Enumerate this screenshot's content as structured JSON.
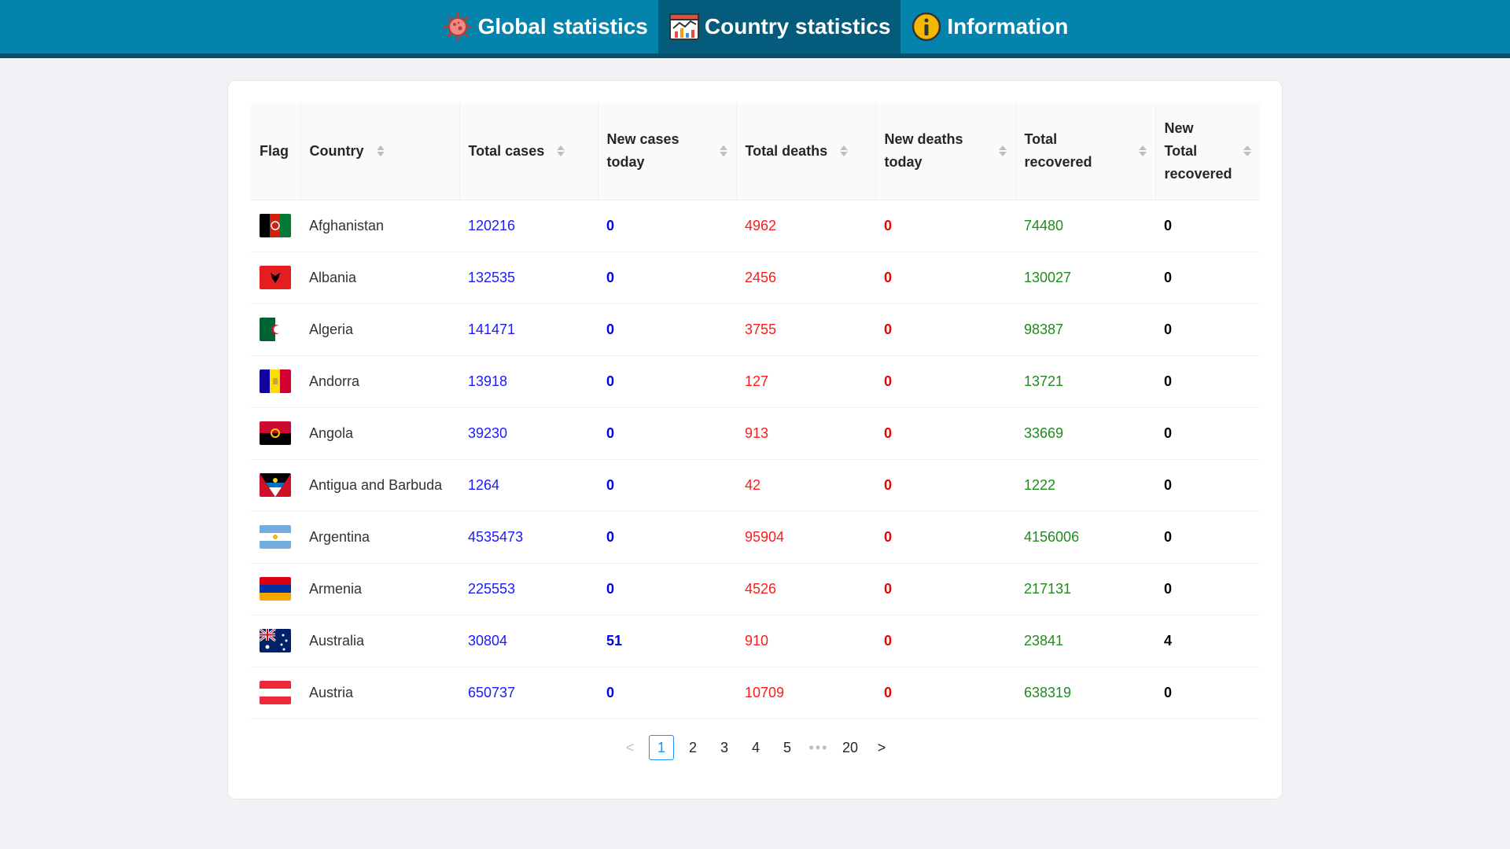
{
  "nav": [
    {
      "label": "Global statistics",
      "icon": "virus-icon"
    },
    {
      "label": "Country statistics",
      "icon": "chart-icon"
    },
    {
      "label": "Information",
      "icon": "info-icon"
    }
  ],
  "table": {
    "headers": {
      "flag": "Flag",
      "country": "Country",
      "total_cases": "Total cases",
      "new_cases_l1": "New cases",
      "new_cases_l2": "today",
      "total_deaths": "Total deaths",
      "new_deaths_l1": "New deaths",
      "new_deaths_l2": "today",
      "total_recovered_l1": "Total",
      "total_recovered_l2": "recovered",
      "new_recovered_l1": "New",
      "new_recovered_l2": "Total",
      "new_recovered_l3": "recovered"
    },
    "rows": [
      {
        "country": "Afghanistan",
        "total_cases": "120216",
        "new_cases": "0",
        "total_deaths": "4962",
        "new_deaths": "0",
        "total_recovered": "74480",
        "new_recovered": "0"
      },
      {
        "country": "Albania",
        "total_cases": "132535",
        "new_cases": "0",
        "total_deaths": "2456",
        "new_deaths": "0",
        "total_recovered": "130027",
        "new_recovered": "0"
      },
      {
        "country": "Algeria",
        "total_cases": "141471",
        "new_cases": "0",
        "total_deaths": "3755",
        "new_deaths": "0",
        "total_recovered": "98387",
        "new_recovered": "0"
      },
      {
        "country": "Andorra",
        "total_cases": "13918",
        "new_cases": "0",
        "total_deaths": "127",
        "new_deaths": "0",
        "total_recovered": "13721",
        "new_recovered": "0"
      },
      {
        "country": "Angola",
        "total_cases": "39230",
        "new_cases": "0",
        "total_deaths": "913",
        "new_deaths": "0",
        "total_recovered": "33669",
        "new_recovered": "0"
      },
      {
        "country": "Antigua and Barbuda",
        "total_cases": "1264",
        "new_cases": "0",
        "total_deaths": "42",
        "new_deaths": "0",
        "total_recovered": "1222",
        "new_recovered": "0"
      },
      {
        "country": "Argentina",
        "total_cases": "4535473",
        "new_cases": "0",
        "total_deaths": "95904",
        "new_deaths": "0",
        "total_recovered": "4156006",
        "new_recovered": "0"
      },
      {
        "country": "Armenia",
        "total_cases": "225553",
        "new_cases": "0",
        "total_deaths": "4526",
        "new_deaths": "0",
        "total_recovered": "217131",
        "new_recovered": "0"
      },
      {
        "country": "Australia",
        "total_cases": "30804",
        "new_cases": "51",
        "total_deaths": "910",
        "new_deaths": "0",
        "total_recovered": "23841",
        "new_recovered": "4"
      },
      {
        "country": "Austria",
        "total_cases": "650737",
        "new_cases": "0",
        "total_deaths": "10709",
        "new_deaths": "0",
        "total_recovered": "638319",
        "new_recovered": "0"
      }
    ]
  },
  "pagination": {
    "prev": "<",
    "pages": [
      "1",
      "2",
      "3",
      "4",
      "5"
    ],
    "ellipsis": "•••",
    "last": "20",
    "next": ">",
    "current": "1"
  },
  "colors": {
    "nav_bg": "#0484ad",
    "nav_active": "#045b7c",
    "cases": "#1a1aff",
    "deaths": "#ff1a1a",
    "recovered": "#1e8c1e"
  }
}
